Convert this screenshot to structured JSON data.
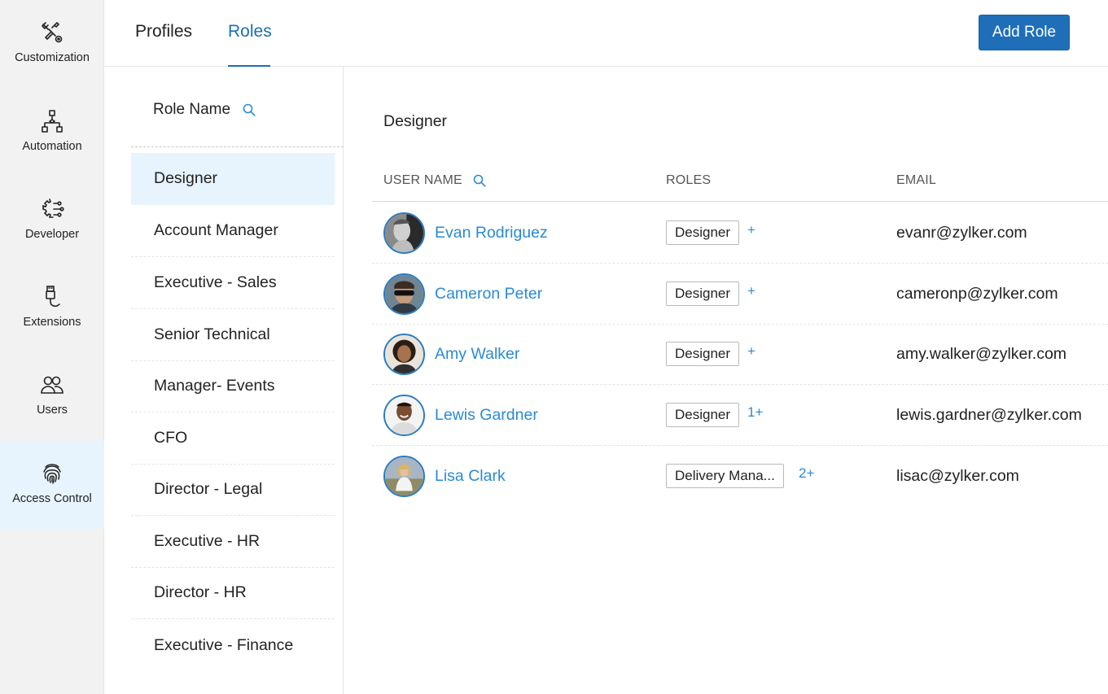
{
  "nav": [
    {
      "label": "Customization",
      "icon": "customization-icon"
    },
    {
      "label": "Automation",
      "icon": "automation-icon"
    },
    {
      "label": "Developer",
      "icon": "developer-icon"
    },
    {
      "label": "Extensions",
      "icon": "extensions-icon"
    },
    {
      "label": "Users",
      "icon": "users-icon"
    },
    {
      "label": "Access Control",
      "icon": "fingerprint-icon",
      "active": true
    }
  ],
  "tabs": [
    {
      "label": "Profiles"
    },
    {
      "label": "Roles",
      "active": true
    }
  ],
  "add_role_label": "Add Role",
  "role_list": {
    "header": "Role Name",
    "items": [
      "Designer",
      "Account Manager",
      "Executive - Sales",
      "Senior Technical",
      "Manager- Events",
      "CFO",
      "Director - Legal",
      "Executive - HR",
      "Director - HR",
      "Executive - Finance"
    ],
    "selected": "Designer"
  },
  "detail": {
    "title": "Designer",
    "columns": {
      "user_name": "USER NAME",
      "roles": "ROLES",
      "email": "EMAIL"
    },
    "users": [
      {
        "name": "Evan Rodriguez",
        "role": "Designer",
        "more": "+",
        "email": "evanr@zylker.com"
      },
      {
        "name": "Cameron Peter",
        "role": "Designer",
        "more": "+",
        "email": "cameronp@zylker.com"
      },
      {
        "name": "Amy Walker",
        "role": "Designer",
        "more": "+",
        "email": "amy.walker@zylker.com"
      },
      {
        "name": "Lewis Gardner",
        "role": "Designer",
        "more": "1+",
        "email": "lewis.gardner@zylker.com"
      },
      {
        "name": "Lisa Clark",
        "role": "Delivery Mana...",
        "more": "2+",
        "email": "lisac@zylker.com"
      }
    ]
  },
  "colors": {
    "accent": "#1e6fb8",
    "link": "#2a8ad4",
    "active_bg": "#e7f3fd",
    "nav_bg": "#f2f2f2"
  }
}
